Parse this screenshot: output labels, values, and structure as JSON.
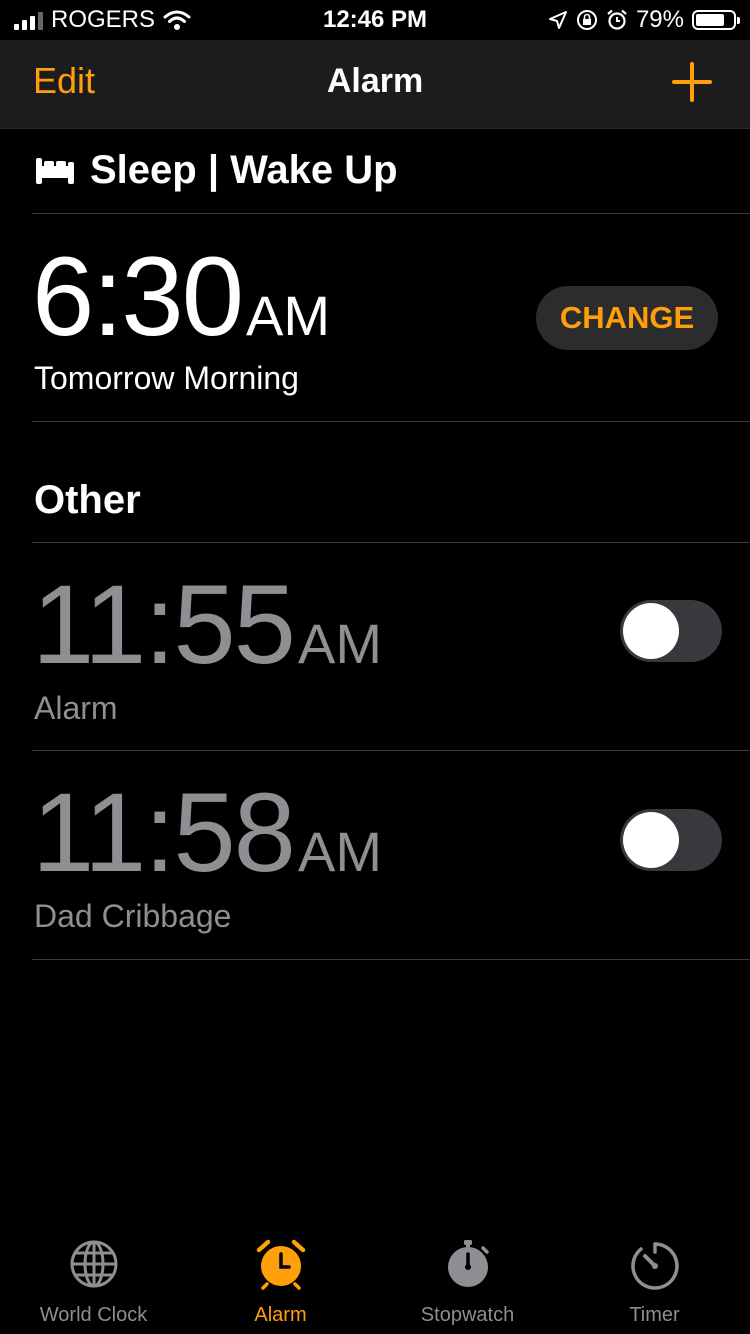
{
  "status_bar": {
    "carrier": "ROGERS",
    "time": "12:46 PM",
    "battery_percent": "79%",
    "battery_level": 0.79,
    "icons": [
      "signal-icon",
      "wifi-icon",
      "location-icon",
      "orientation-lock-icon",
      "alarm-status-icon",
      "battery-icon"
    ]
  },
  "nav": {
    "edit_label": "Edit",
    "title": "Alarm",
    "add_icon": "plus-icon"
  },
  "sleep": {
    "icon": "bed-icon",
    "section_title": "Sleep | Wake Up",
    "time": "6:30",
    "ampm": "AM",
    "label": "Tomorrow Morning",
    "change_label": "CHANGE"
  },
  "other": {
    "section_title": "Other",
    "alarms": [
      {
        "time": "11:55",
        "ampm": "AM",
        "label": "Alarm",
        "enabled": false
      },
      {
        "time": "11:58",
        "ampm": "AM",
        "label": "Dad Cribbage",
        "enabled": false
      }
    ]
  },
  "tabs": [
    {
      "label": "World Clock",
      "icon": "globe-icon",
      "selected": false
    },
    {
      "label": "Alarm",
      "icon": "alarm-clock-icon",
      "selected": true
    },
    {
      "label": "Stopwatch",
      "icon": "stopwatch-icon",
      "selected": false
    },
    {
      "label": "Timer",
      "icon": "timer-icon",
      "selected": false
    }
  ],
  "colors": {
    "accent": "#ff9f0a",
    "background": "#000000",
    "inactive_text": "#8e8e93"
  }
}
